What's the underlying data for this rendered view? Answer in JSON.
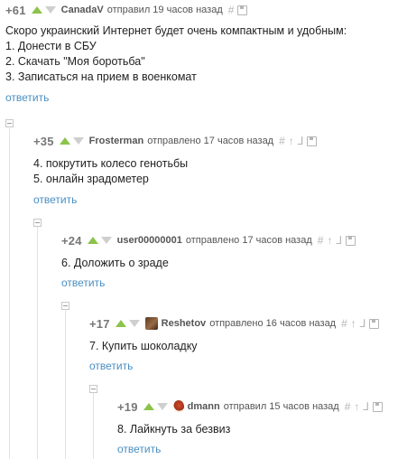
{
  "comments": [
    {
      "score": "+61",
      "user": "CanadaV",
      "action": "отправил 19 часов назад",
      "lines": [
        "Скоро украинский Интернет будет очень компактным и удобным:",
        "1. Донести в СБУ",
        "2. Скачать \"Моя боротьба\"",
        "3. Записаться на прием в военкомат"
      ],
      "reply": "ответить"
    },
    {
      "score": "+35",
      "user": "Frosterman",
      "action": "отправлено 17 часов назад",
      "lines": [
        "4. покрутить колесо генотьбы",
        "5. онлайн зрадометер"
      ],
      "reply": "ответить"
    },
    {
      "score": "+24",
      "user": "user00000001",
      "action": "отправлено 17 часов назад",
      "lines": [
        "6. Доложить о зраде"
      ],
      "reply": "ответить"
    },
    {
      "score": "+17",
      "user": "Reshetov",
      "action": "отправлено 16 часов назад",
      "lines": [
        "7. Купить шоколадку"
      ],
      "reply": "ответить"
    },
    {
      "score": "+19",
      "user": "dmann",
      "action": "отправил 15 часов назад",
      "lines": [
        "8. Лайкнуть за безвиз"
      ],
      "reply": "ответить"
    }
  ],
  "icons": {
    "hash": "#",
    "up_to_parent": "↑",
    "branch": "⅃",
    "save": "save-icon"
  },
  "colors": {
    "upvote": "#8bc34a",
    "downvote": "#cfcfcf",
    "reply_link": "#4a8ec2"
  }
}
